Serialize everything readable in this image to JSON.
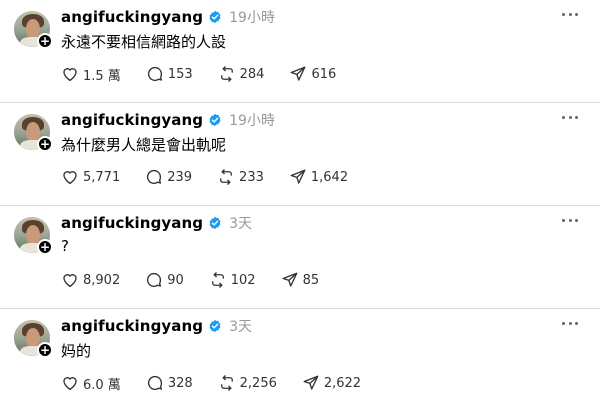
{
  "posts": [
    {
      "username": "angifuckingyang",
      "time": "19小時",
      "text": "永遠不要相信網路的人設",
      "likes": "1.5 萬",
      "replies": "153",
      "reposts": "284",
      "shares": "616"
    },
    {
      "username": "angifuckingyang",
      "time": "19小時",
      "text": "為什麼男人總是會出軌呢",
      "likes": "5,771",
      "replies": "239",
      "reposts": "233",
      "shares": "1,642"
    },
    {
      "username": "angifuckingyang",
      "time": "3天",
      "text": "?",
      "likes": "8,902",
      "replies": "90",
      "reposts": "102",
      "shares": "85"
    },
    {
      "username": "angifuckingyang",
      "time": "3天",
      "text": "妈的",
      "likes": "6.0 萬",
      "replies": "328",
      "reposts": "2,256",
      "shares": "2,622"
    }
  ],
  "colors": {
    "verified": "#1d9bf0",
    "muted": "#999999",
    "divider": "#dcdcdc"
  },
  "icons": [
    "heart-icon",
    "comment-icon",
    "repost-icon",
    "share-icon",
    "verified-icon",
    "more-icon",
    "follow-plus-icon"
  ]
}
